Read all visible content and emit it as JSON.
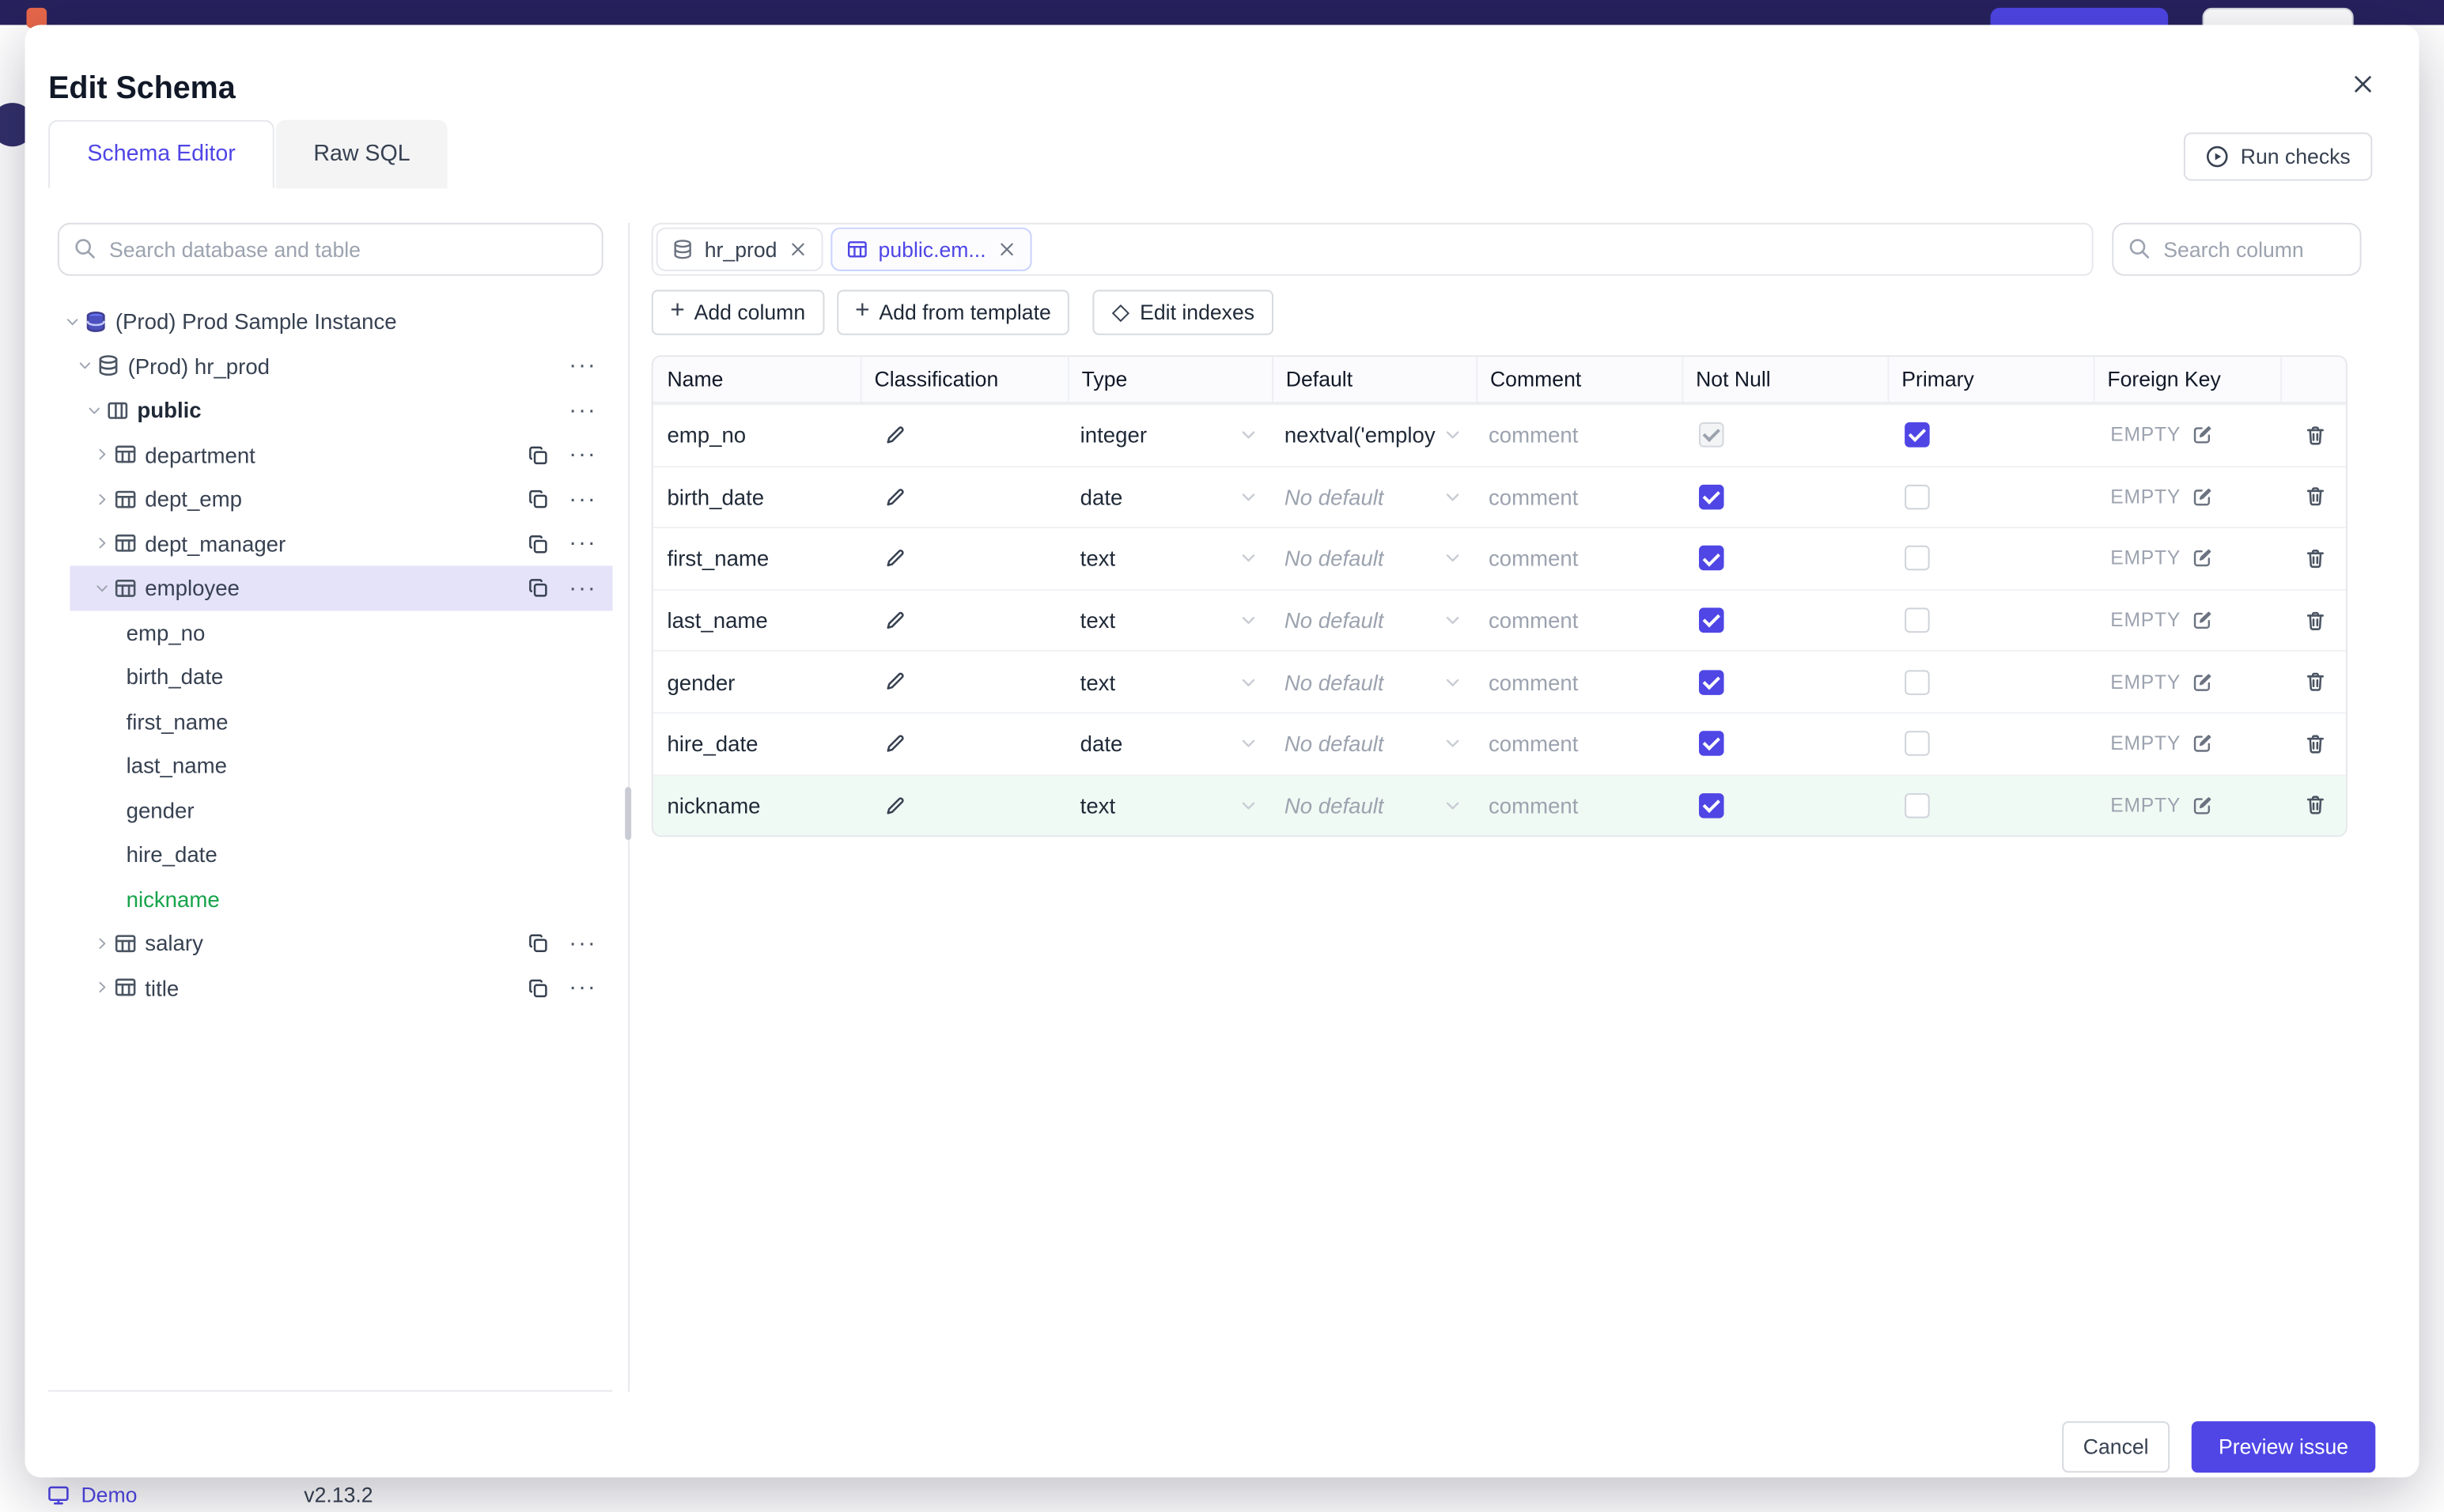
{
  "page": {
    "demo_label": "Demo",
    "version": "v2.13.2"
  },
  "modal": {
    "title": "Edit Schema",
    "tab_schema_editor": "Schema Editor",
    "tab_raw_sql": "Raw SQL",
    "run_checks_label": "Run checks",
    "cancel_label": "Cancel",
    "preview_label": "Preview issue"
  },
  "sidebar": {
    "search_placeholder": "Search database and table",
    "tree": [
      {
        "label": "(Prod) Prod Sample Instance"
      },
      {
        "label": "(Prod) hr_prod"
      },
      {
        "label": "public"
      },
      {
        "label": "department"
      },
      {
        "label": "dept_emp"
      },
      {
        "label": "dept_manager"
      },
      {
        "label": "employee"
      },
      {
        "label": "emp_no"
      },
      {
        "label": "birth_date"
      },
      {
        "label": "first_name"
      },
      {
        "label": "last_name"
      },
      {
        "label": "gender"
      },
      {
        "label": "hire_date"
      },
      {
        "label": "nickname"
      },
      {
        "label": "salary"
      },
      {
        "label": "title"
      }
    ]
  },
  "editor": {
    "tabs": [
      {
        "label": "hr_prod"
      },
      {
        "label": "public.em..."
      }
    ],
    "column_search_placeholder": "Search column",
    "toolbar": {
      "add_column": "Add column",
      "add_from_template": "Add from template",
      "edit_indexes": "Edit indexes"
    },
    "table": {
      "headers": [
        "Name",
        "Classification",
        "Type",
        "Default",
        "Comment",
        "Not Null",
        "Primary",
        "Foreign Key"
      ],
      "comment_placeholder": "comment",
      "fk_empty": "EMPTY",
      "rows": [
        {
          "name": "emp_no",
          "type": "integer",
          "default": "nextval('employ",
          "is_placeholder_default": false,
          "not_null": true,
          "not_null_disabled": true,
          "primary": true,
          "highlight": false
        },
        {
          "name": "birth_date",
          "type": "date",
          "default": "No default",
          "is_placeholder_default": true,
          "not_null": true,
          "not_null_disabled": false,
          "primary": false,
          "highlight": false
        },
        {
          "name": "first_name",
          "type": "text",
          "default": "No default",
          "is_placeholder_default": true,
          "not_null": true,
          "not_null_disabled": false,
          "primary": false,
          "highlight": false
        },
        {
          "name": "last_name",
          "type": "text",
          "default": "No default",
          "is_placeholder_default": true,
          "not_null": true,
          "not_null_disabled": false,
          "primary": false,
          "highlight": false
        },
        {
          "name": "gender",
          "type": "text",
          "default": "No default",
          "is_placeholder_default": true,
          "not_null": true,
          "not_null_disabled": false,
          "primary": false,
          "highlight": false
        },
        {
          "name": "hire_date",
          "type": "date",
          "default": "No default",
          "is_placeholder_default": true,
          "not_null": true,
          "not_null_disabled": false,
          "primary": false,
          "highlight": false
        },
        {
          "name": "nickname",
          "type": "text",
          "default": "No default",
          "is_placeholder_default": true,
          "not_null": true,
          "not_null_disabled": false,
          "primary": false,
          "highlight": true
        }
      ]
    }
  }
}
